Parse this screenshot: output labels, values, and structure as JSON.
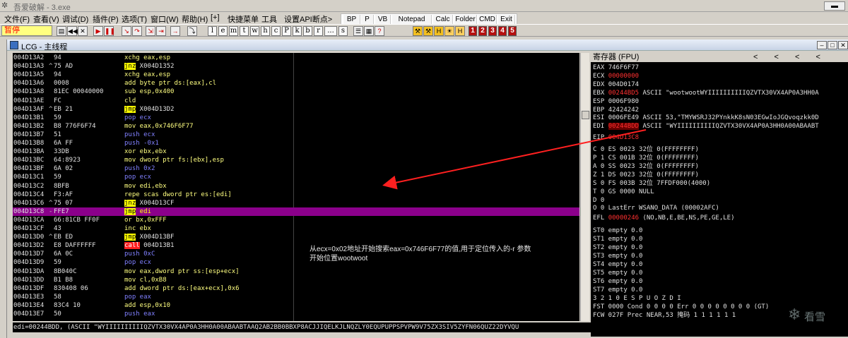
{
  "app": {
    "title": "吾爱破解 - 3.exe",
    "icon": "bug-icon",
    "minimize_label": "▬"
  },
  "menu": {
    "items": [
      "文件(F)",
      "查看(V)",
      "调试(D)",
      "插件(P)",
      "选项(T)",
      "窗口(W)",
      "帮助(H)",
      "[+]",
      "快捷菜单",
      "工具",
      "设置API断点>"
    ]
  },
  "plugbar": {
    "buttons": [
      "BP",
      "P",
      "VB",
      "Notepad",
      "Calc",
      "Folder",
      "CMD",
      "Exit"
    ]
  },
  "toolbar": {
    "status": "暂停",
    "letters": [
      "l",
      "e",
      "m",
      "t",
      "w",
      "h",
      "c",
      "P",
      "k",
      "b",
      "r",
      "...",
      "s"
    ],
    "numbers": [
      "1",
      "2",
      "3",
      "4",
      "5"
    ]
  },
  "cpu_window": {
    "title": "LCG - 主线程"
  },
  "disasm": {
    "rows": [
      {
        "addr": "004D13A2",
        "mark": "",
        "hex": "94",
        "ins": "xchg eax,esp",
        "kind": "norm"
      },
      {
        "addr": "004D13A3",
        "mark": "^",
        "hex": "75 AD",
        "ins": "jnz X004D1352",
        "kind": "jmp"
      },
      {
        "addr": "004D13A5",
        "mark": "",
        "hex": "94",
        "ins": "xchg eax,esp",
        "kind": "norm"
      },
      {
        "addr": "004D13A6",
        "mark": "",
        "hex": "0008",
        "ins": "add byte ptr ds:[eax],cl",
        "kind": "norm"
      },
      {
        "addr": "004D13A8",
        "mark": "",
        "hex": "81EC 00040000",
        "ins": "sub esp,0x400",
        "kind": "norm"
      },
      {
        "addr": "004D13AE",
        "mark": "",
        "hex": "FC",
        "ins": "cld",
        "kind": "norm"
      },
      {
        "addr": "004D13AF",
        "mark": "^",
        "hex": "EB 21",
        "ins": "jmp X004D13D2",
        "kind": "jmp"
      },
      {
        "addr": "004D13B1",
        "mark": "",
        "hex": "59",
        "ins": "pop ecx",
        "kind": "stack"
      },
      {
        "addr": "004D13B2",
        "mark": "",
        "hex": "B8 776F6F74",
        "ins": "mov eax,0x746F6F77",
        "kind": "norm"
      },
      {
        "addr": "004D13B7",
        "mark": "",
        "hex": "51",
        "ins": "push ecx",
        "kind": "stack"
      },
      {
        "addr": "004D13B8",
        "mark": "",
        "hex": "6A FF",
        "ins": "push -0x1",
        "kind": "stack"
      },
      {
        "addr": "004D13BA",
        "mark": "",
        "hex": "33DB",
        "ins": "xor ebx,ebx",
        "kind": "norm"
      },
      {
        "addr": "004D13BC",
        "mark": "",
        "hex": "64:8923",
        "ins": "mov dword ptr fs:[ebx],esp",
        "kind": "norm"
      },
      {
        "addr": "004D13BF",
        "mark": "",
        "hex": "6A 02",
        "ins": "push 0x2",
        "kind": "stack"
      },
      {
        "addr": "004D13C1",
        "mark": "",
        "hex": "59",
        "ins": "pop ecx",
        "kind": "stack"
      },
      {
        "addr": "004D13C2",
        "mark": "",
        "hex": "8BFB",
        "ins": "mov edi,ebx",
        "kind": "norm"
      },
      {
        "addr": "004D13C4",
        "mark": "",
        "hex": "F3:AF",
        "ins": "repe scas dword ptr es:[edi]",
        "kind": "norm"
      },
      {
        "addr": "004D13C6",
        "mark": "^",
        "hex": "75 07",
        "ins": "jnz X004D13CF",
        "kind": "jmp"
      },
      {
        "addr": "004D13C8",
        "mark": "-",
        "hex": "FFE7",
        "ins": "jmp edi",
        "kind": "jmp",
        "highlight": true
      },
      {
        "addr": "004D13CA",
        "mark": "",
        "hex": "66:81CB FF0F",
        "ins": "or bx,0xFFF",
        "kind": "norm"
      },
      {
        "addr": "004D13CF",
        "mark": "",
        "hex": "43",
        "ins": "inc ebx",
        "kind": "norm"
      },
      {
        "addr": "004D13D0",
        "mark": "^",
        "hex": "EB ED",
        "ins": "jmp X004D13BF",
        "kind": "jmp"
      },
      {
        "addr": "004D13D2",
        "mark": "",
        "hex": "E8 DAFFFFFF",
        "ins": "call 004D13B1",
        "kind": "call"
      },
      {
        "addr": "004D13D7",
        "mark": "",
        "hex": "6A 0C",
        "ins": "push 0xC",
        "kind": "stack"
      },
      {
        "addr": "004D13D9",
        "mark": "",
        "hex": "59",
        "ins": "pop ecx",
        "kind": "stack"
      },
      {
        "addr": "004D13DA",
        "mark": "",
        "hex": "8B040C",
        "ins": "mov eax,dword ptr ss:[esp+ecx]",
        "kind": "norm"
      },
      {
        "addr": "004D13DD",
        "mark": "",
        "hex": "B1 B8",
        "ins": "mov cl,0xB8",
        "kind": "norm"
      },
      {
        "addr": "004D13DF",
        "mark": "",
        "hex": "830408 06",
        "ins": "add dword ptr ds:[eax+ecx],0x6",
        "kind": "norm"
      },
      {
        "addr": "004D13E3",
        "mark": "",
        "hex": "58",
        "ins": "pop eax",
        "kind": "stack"
      },
      {
        "addr": "004D13E4",
        "mark": "",
        "hex": "83C4 10",
        "ins": "add esp,0x10",
        "kind": "norm"
      },
      {
        "addr": "004D13E7",
        "mark": "",
        "hex": "50",
        "ins": "push eax",
        "kind": "stack"
      }
    ],
    "comment_line1": "从ecx=0x02地址开始搜索eax=0x746F6F77的值,用于定位传入的-r 参数",
    "comment_line2": "开始位置wootwoot"
  },
  "infoline": "edi=00244BDD, (ASCII \"WYIIIIIIIIIIQZVTX30VX4AP0A3HH0A00ABAABTAAQ2AB2BB0BBXP8ACJJIQELKJLNQZLY0EQUPUPPSPVPW9V75ZX3SIV5ZYFN06QUZ22DYVQU",
  "registers": {
    "header": "寄存器 (FPU)",
    "arrows": "< < < < <",
    "rows": [
      {
        "name": "EAX",
        "value": "746F6F77",
        "note": "",
        "style": ""
      },
      {
        "name": "ECX",
        "value": "00000000",
        "note": "",
        "style": "red"
      },
      {
        "name": "EDX",
        "value": "004D0174",
        "note": "",
        "style": ""
      },
      {
        "name": "EBX",
        "value": "00244BD5",
        "note": "ASCII \"wootwootWYIIIIIIIIIIQZVTX30VX4AP0A3HH0A",
        "style": "red"
      },
      {
        "name": "ESP",
        "value": "0006F980",
        "note": "",
        "style": ""
      },
      {
        "name": "EBP",
        "value": "42424242",
        "note": "",
        "style": ""
      },
      {
        "name": "ESI",
        "value": "0006FE49",
        "note": "ASCII 53,\"TMYWSRJ32PYnkkK8sN03EGwIoJGQvoqzkk0D",
        "style": ""
      },
      {
        "name": "EDI",
        "value": "00244BDD",
        "note": "ASCII \"WYIIIIIIIIIIQZVTX30VX4AP0A3HH0A00ABAABT",
        "style": "redbg"
      },
      {
        "name": "",
        "value": "",
        "note": "",
        "style": ""
      },
      {
        "name": "EIP",
        "value": "004D13C8",
        "note": "",
        "style": "red"
      }
    ],
    "flags": [
      "C 0  ES 0023 32位 0(FFFFFFFF)",
      "P 1  CS 001B 32位 0(FFFFFFFF)",
      "A 0  SS 0023 32位 0(FFFFFFFF)",
      "Z 1  DS 0023 32位 0(FFFFFFFF)",
      "S 0  FS 003B 32位 7FFDF000(4000)",
      "T 0  GS 0000 NULL",
      "D 0",
      "O 0  LastErr WSANO_DATA (00002AFC)"
    ],
    "efl_label": "EFL",
    "efl_value": "00000246",
    "efl_note": "(NO,NB,E,BE,NS,PE,GE,LE)",
    "st": [
      "ST0 empty 0.0",
      "ST1 empty 0.0",
      "ST2 empty 0.0",
      "ST3 empty 0.0",
      "ST4 empty 0.0",
      "ST5 empty 0.0",
      "ST6 empty 0.0",
      "ST7 empty 0.0"
    ],
    "fpu_hdr": "               3 2 1 0      E S P U O Z D I",
    "fst": "FST 0000  Cond 0 0 0 0  Err 0 0 0 0 0 0 0 0  (GT)",
    "fcw": "FCW 027F  Prec NEAR,53  掩码    1 1 1 1 1 1"
  },
  "watermark": "看雪"
}
